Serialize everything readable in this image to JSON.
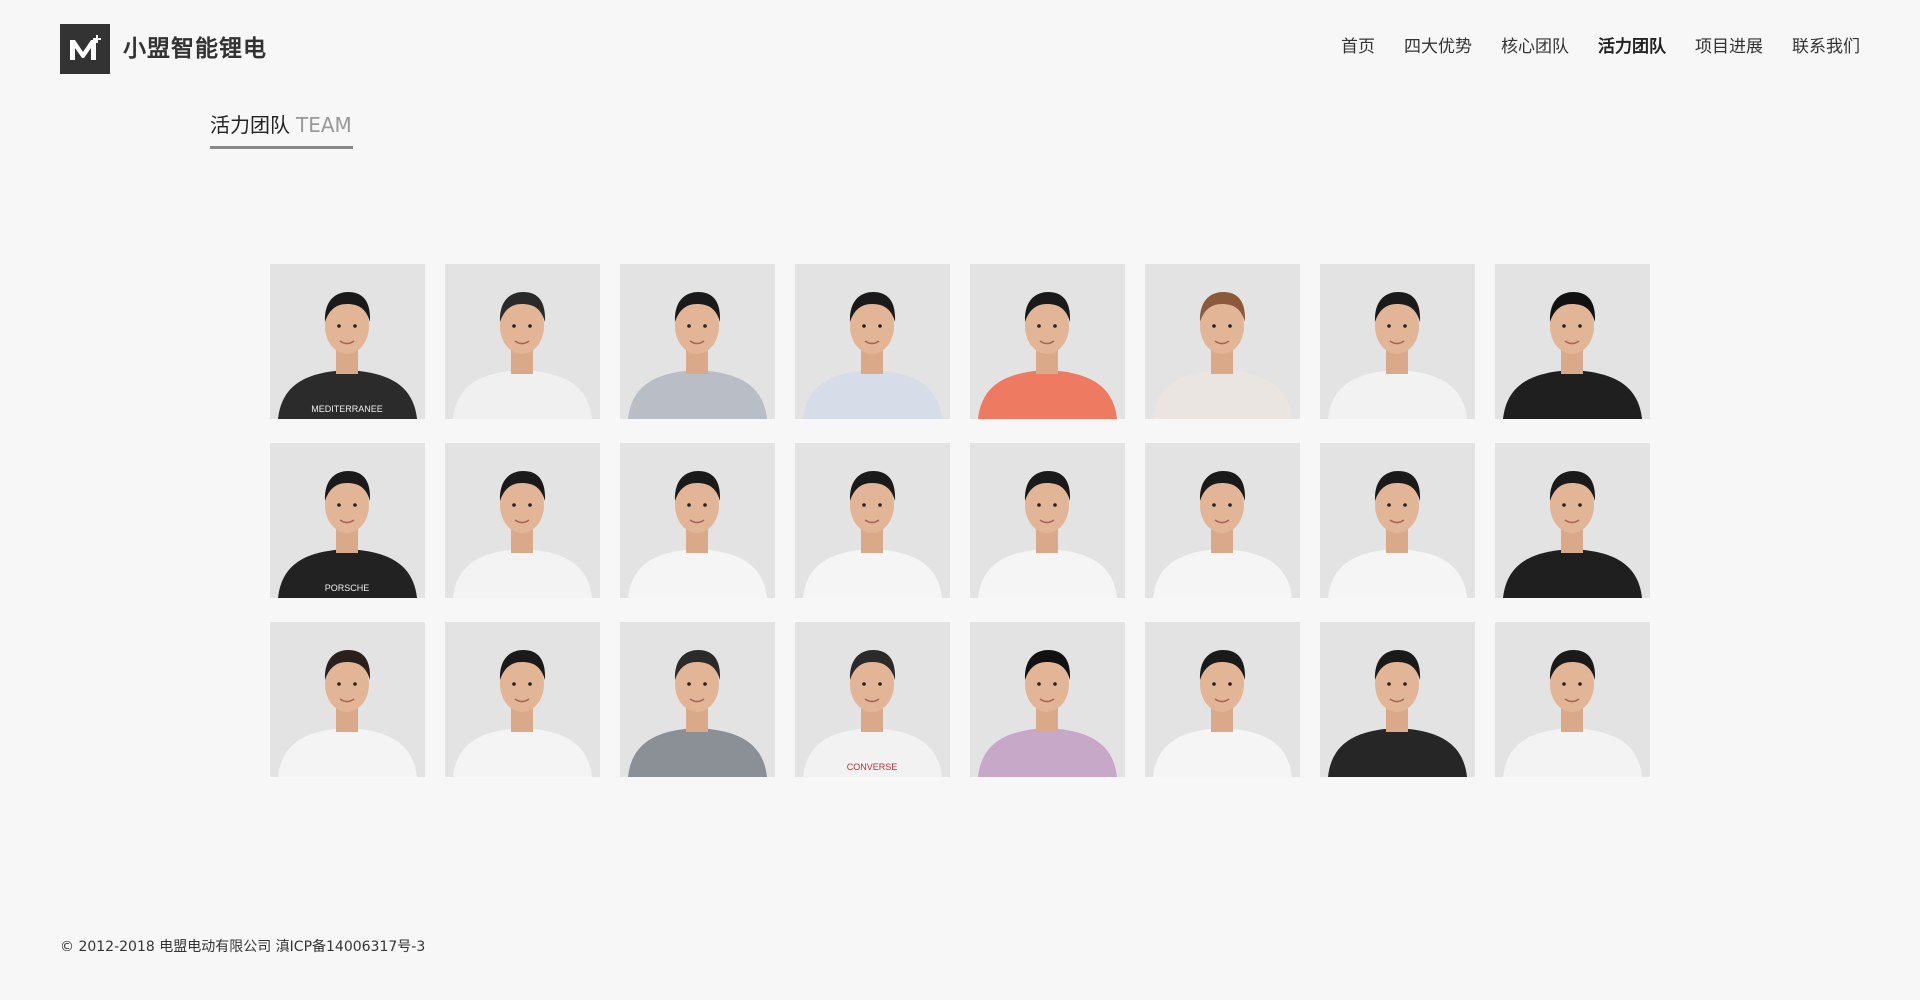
{
  "brand": {
    "logo_icon": "m-plus-logo-icon",
    "name": "小盟智能锂电"
  },
  "nav": {
    "items": [
      {
        "label": "首页"
      },
      {
        "label": "四大优势"
      },
      {
        "label": "核心团队"
      },
      {
        "label": "活力团队",
        "active": true
      },
      {
        "label": "项目进展"
      },
      {
        "label": "联系我们"
      }
    ]
  },
  "section": {
    "title_cn": "活力团队",
    "title_en": "TEAM"
  },
  "team": [
    {
      "shirt": "#2b2b2b",
      "hair": "#1a1a1a",
      "shirt_text": "MEDITERRANEE"
    },
    {
      "shirt": "#f0f0f0",
      "hair": "#2a2a2a"
    },
    {
      "shirt": "#b9bec6",
      "hair": "#1a1a1a"
    },
    {
      "shirt": "#d7dde8",
      "hair": "#1a1a1a"
    },
    {
      "shirt": "#ef7a62",
      "hair": "#1a1a1a"
    },
    {
      "shirt": "#eae5e0",
      "hair": "#8a5a3a"
    },
    {
      "shirt": "#f2f2f2",
      "hair": "#1a1a1a"
    },
    {
      "shirt": "#1f1f1f",
      "hair": "#111111"
    },
    {
      "shirt": "#222222",
      "hair": "#1a1a1a",
      "shirt_text": "PORSCHE"
    },
    {
      "shirt": "#f3f3f3",
      "hair": "#1a1a1a"
    },
    {
      "shirt": "#f5f5f5",
      "hair": "#1a1a1a"
    },
    {
      "shirt": "#f5f5f5",
      "hair": "#1a1a1a"
    },
    {
      "shirt": "#f5f5f5",
      "hair": "#1a1a1a"
    },
    {
      "shirt": "#f5f5f5",
      "hair": "#1a1a1a"
    },
    {
      "shirt": "#f5f5f5",
      "hair": "#1a1a1a"
    },
    {
      "shirt": "#1f1f1f",
      "hair": "#1a1a1a"
    },
    {
      "shirt": "#f4f4f4",
      "hair": "#2a1f1a"
    },
    {
      "shirt": "#f4f4f4",
      "hair": "#1a1a1a"
    },
    {
      "shirt": "#8b8f96",
      "hair": "#2a2a2a"
    },
    {
      "shirt": "#f2f2f2",
      "hair": "#2a2a2a",
      "shirt_text": "CONVERSE"
    },
    {
      "shirt": "#c8a8c8",
      "hair": "#111111"
    },
    {
      "shirt": "#f5f5f5",
      "hair": "#1a1a1a"
    },
    {
      "shirt": "#262626",
      "hair": "#1a1a1a"
    },
    {
      "shirt": "#f3f3f3",
      "hair": "#1a1a1a"
    }
  ],
  "footer": {
    "text": "© 2012-2018 电盟电动有限公司 滇ICP备14006317号-3"
  }
}
